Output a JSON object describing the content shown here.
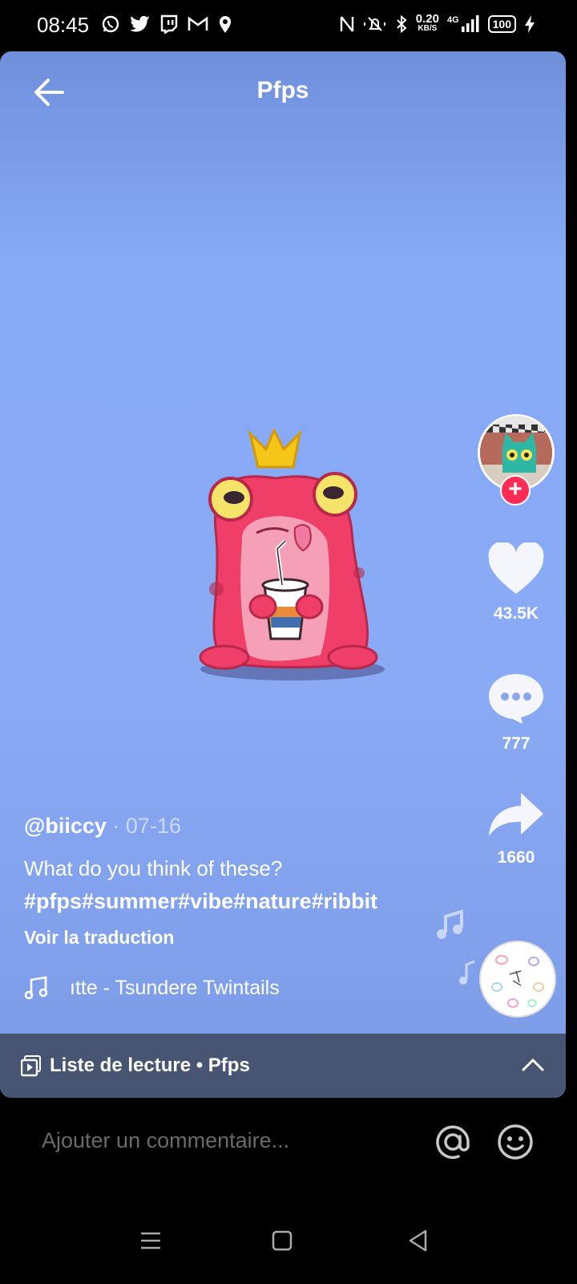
{
  "status_bar": {
    "time": "08:45",
    "net_speed_value": "0.20",
    "net_speed_unit": "KB/S",
    "network_type": "4G",
    "battery": "100",
    "left_icons": [
      "whatsapp-icon",
      "twitter-icon",
      "twitch-icon",
      "gmail-icon",
      "location-icon"
    ],
    "right_icons": [
      "nfc-icon",
      "mute-icon",
      "bluetooth-icon",
      "signal-icon",
      "battery-icon",
      "charging-icon"
    ]
  },
  "header": {
    "title": "Pfps"
  },
  "video": {
    "author": "@biiccy",
    "date_separator": "·",
    "date": "07-16",
    "description": "What do you think of these?",
    "hashtags": "#pfps#summer#vibe#nature#ribbit",
    "translate_label": "Voir la traduction",
    "music": " ıtte - Tsundere Twintails"
  },
  "actions": {
    "likes": "43.5K",
    "comments": "777",
    "shares": "1660"
  },
  "playlist": {
    "label": "Liste de lecture • Pfps"
  },
  "comment": {
    "placeholder": "Ajouter un commentaire..."
  },
  "colors": {
    "accent": "#fe2c55",
    "background_top": "#6f8fdb",
    "background_mid": "#86aaf6",
    "playlist_bar": "#485572"
  }
}
